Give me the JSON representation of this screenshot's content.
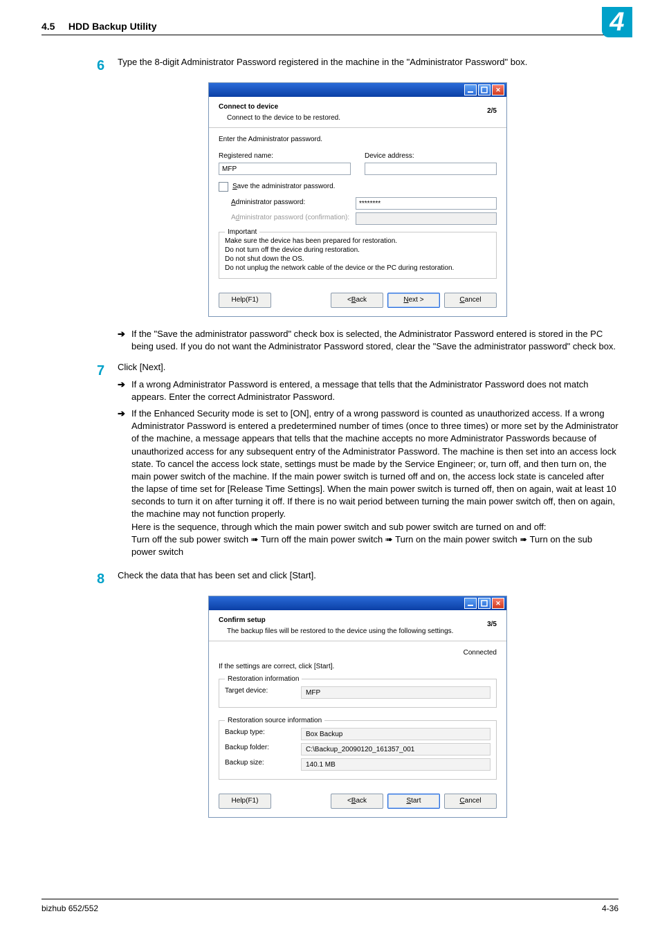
{
  "header": {
    "section_number": "4.5",
    "section_title": "HDD Backup Utility",
    "chapter_badge": "4"
  },
  "steps": {
    "s6": {
      "num": "6",
      "text": "Type the 8-digit Administrator Password registered in the machine in the \"Administrator Password\" box.",
      "note": "If the \"Save the administrator password\" check box is selected, the Administrator Password entered is stored in the PC being used. If you do not want the Administrator Password stored, clear the \"Save the administrator password\" check box."
    },
    "s7": {
      "num": "7",
      "text": "Click [Next].",
      "b1": "If a wrong Administrator Password is entered, a message that tells that the Administrator Password does not match appears. Enter the correct Administrator Password.",
      "b2": "If the Enhanced Security mode is set to [ON], entry of a wrong password is counted as unauthorized access. If a wrong Administrator Password is entered a predetermined number of times (once to three times) or more set by the Administrator of the machine, a message appears that tells that the machine accepts no more Administrator Passwords because of unauthorized access for any subsequent entry of the Administrator Password. The machine is then set into an access lock state. To cancel the access lock state, settings must be made by the Service Engineer; or, turn off, and then turn on, the main power switch of the machine. If the main power switch is turned off and on, the access lock state is canceled after the lapse of time set for [Release Time Settings]. When the main power switch is turned off, then on again, wait at least 10 seconds to turn it on after turning it off. If there is no wait period between turning the main power switch off, then on again, the machine may not function properly.",
      "b2_seq_intro": "Here is the sequence, through which the main power switch and sub power switch are turned on and off:",
      "b2_seq": "Turn off the sub power switch ➠ Turn off the main power switch ➠ Turn on the main power switch ➠ Turn on the sub power switch"
    },
    "s8": {
      "num": "8",
      "text": "Check the data that has been set and click [Start]."
    }
  },
  "dialog1": {
    "title": "Connect to device",
    "subtitle": "Connect to the device to be restored.",
    "pager": "2/5",
    "instruction": "Enter the Administrator password.",
    "registered_name_label": "Registered name:",
    "registered_name_value": "MFP",
    "device_address_label": "Device address:",
    "device_address_value": "",
    "save_pw_label": "Save the administrator password.",
    "admin_pw_label": "Administrator password:",
    "admin_pw_value": "********",
    "admin_pw_conf_label": "Administrator password (confirmation):",
    "important_legend": "Important",
    "imp1": "Make sure the device has been prepared for restoration.",
    "imp2": "Do not turn off the device during restoration.",
    "imp3": "Do not shut down the OS.",
    "imp4": "Do not unplug the network cable of the device or the PC during restoration.",
    "help": "Help(F1)",
    "back": "< Back",
    "next": "Next >",
    "cancel": "Cancel"
  },
  "dialog2": {
    "title": "Confirm setup",
    "subtitle": "The backup files will be restored to the device using the following settings.",
    "pager": "3/5",
    "connected": "Connected",
    "instruction": "If the settings are correct, click [Start].",
    "rest_info_legend": "Restoration information",
    "target_device_label": "Target device:",
    "target_device_value": "MFP",
    "rest_src_legend": "Restoration source information",
    "backup_type_label": "Backup type:",
    "backup_type_value": "Box Backup",
    "backup_folder_label": "Backup folder:",
    "backup_folder_value": "C:\\Backup_20090120_161357_001",
    "backup_size_label": "Backup size:",
    "backup_size_value": "140.1 MB",
    "help": "Help(F1)",
    "back": "< Back",
    "start": "Start",
    "cancel": "Cancel"
  },
  "footer": {
    "model": "bizhub 652/552",
    "page": "4-36"
  }
}
